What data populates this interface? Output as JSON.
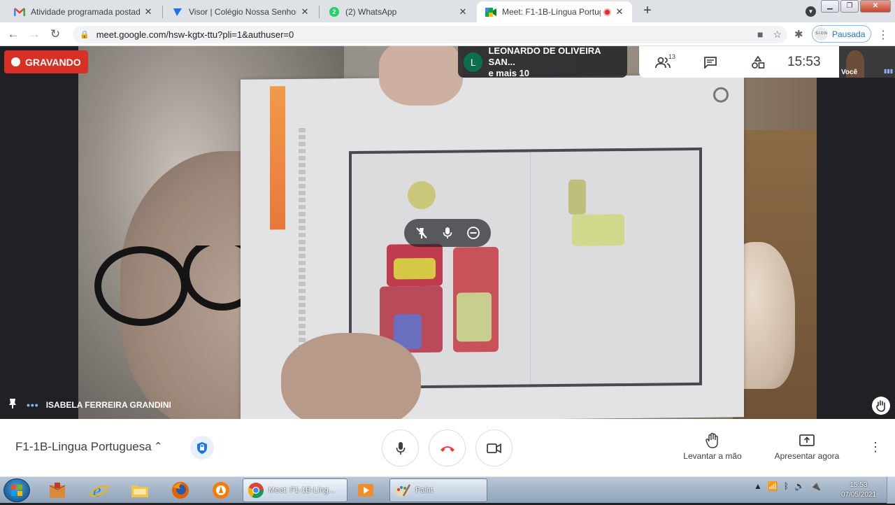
{
  "browser": {
    "tabs": [
      {
        "title": "Atividade programada postada: \"",
        "icon": "gmail-icon"
      },
      {
        "title": "Visor | Colégio Nossa Senhora Co",
        "icon": "visor-icon"
      },
      {
        "title": "(2) WhatsApp",
        "icon": "whatsapp-icon",
        "badge": "2"
      },
      {
        "title": "Meet: F1-1B-Língua Portugu",
        "icon": "meet-icon",
        "recording": true
      }
    ],
    "url": "meet.google.com/hsw-kgtx-ttu?pli=1&authuser=0",
    "profile_status": "Pausada",
    "profile_avatar_text": "S.I.O.N"
  },
  "meet": {
    "recording_label": "GRAVANDO",
    "presenter_initial": "L",
    "presenter_name": "LEONARDO DE OLIVEIRA SAN...",
    "presenter_more": "e mais 10",
    "participants_count": "13",
    "clock": "15:53",
    "self_label": "Você",
    "tile_name": "ISABELA FERREIRA GRANDINI",
    "meeting_title": "F1-1B-Lingua Portuguesa",
    "raise_hand_label": "Levantar a mão",
    "present_label": "Apresentar agora"
  },
  "taskbar": {
    "apps": [
      {
        "label": "Meet: F1-1B-Líng...",
        "icon": "chrome-icon"
      },
      {
        "label": "Paint",
        "icon": "paint-icon"
      }
    ],
    "time": "15:53",
    "date": "07/05/2021"
  },
  "colors": {
    "recording": "#d93025",
    "accent": "#1a73e8",
    "end_call": "#ea4335"
  }
}
